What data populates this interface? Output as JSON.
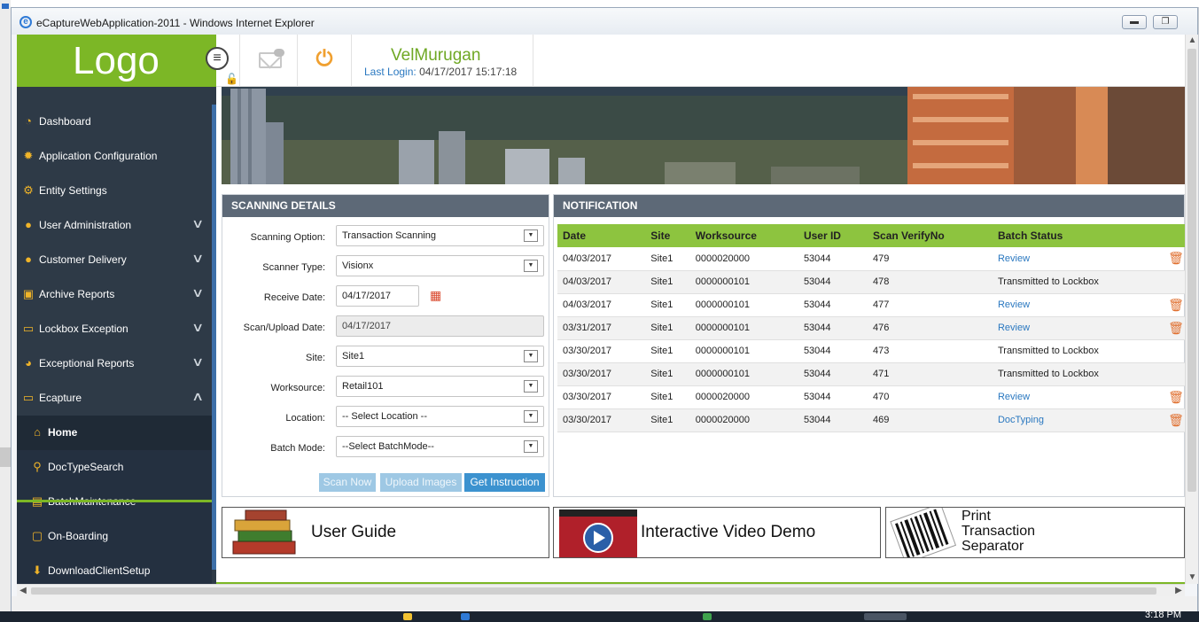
{
  "window": {
    "title": "eCaptureWebApplication-2011 - Windows Internet Explorer",
    "minimize": "▬",
    "restore": "❐"
  },
  "logo": "Logo",
  "header": {
    "username": "VelMurugan",
    "last_login_label": "Last Login:",
    "last_login_value": "04/17/2017 15:17:18"
  },
  "sidebar": {
    "items": [
      {
        "label": "Dashboard",
        "icon": "dashboard-icon",
        "glyph": "◔"
      },
      {
        "label": "Application Configuration",
        "icon": "gear-icon",
        "glyph": "✹"
      },
      {
        "label": "Entity Settings",
        "icon": "gears-icon",
        "glyph": "⚙"
      },
      {
        "label": "User Administration",
        "icon": "user-icon",
        "glyph": "●",
        "expandable": true
      },
      {
        "label": "Customer Delivery",
        "icon": "customer-icon",
        "glyph": "●",
        "expandable": true
      },
      {
        "label": "Archive Reports",
        "icon": "box-icon",
        "glyph": "▣",
        "expandable": true
      },
      {
        "label": "Lockbox Exception",
        "icon": "inbox-icon",
        "glyph": "▭",
        "expandable": true
      },
      {
        "label": "Exceptional Reports",
        "icon": "pie-chart-icon",
        "glyph": "◕",
        "expandable": true
      },
      {
        "label": "Ecapture",
        "icon": "inbox-icon",
        "glyph": "▭",
        "expandable": true,
        "expanded": true
      }
    ],
    "subitems": [
      {
        "label": "Home",
        "icon": "home-icon",
        "glyph": "⌂",
        "active": true
      },
      {
        "label": "DocTypeSearch",
        "icon": "search-icon",
        "glyph": "⚲"
      },
      {
        "label": "BatchMaintenance",
        "icon": "batch-icon",
        "glyph": "▤"
      },
      {
        "label": "On-Boarding",
        "icon": "square-icon",
        "glyph": "▢"
      },
      {
        "label": "DownloadClientSetup",
        "icon": "download-icon",
        "glyph": "⬇"
      }
    ],
    "chevron_down": "∨",
    "chevron_up": "∧"
  },
  "scanning": {
    "title": "SCANNING DETAILS",
    "fields": [
      {
        "label": "Scanning Option:",
        "value": "Transaction Scanning"
      },
      {
        "label": "Scanner Type:",
        "value": "Visionx"
      },
      {
        "label": "Receive Date:",
        "value": "04/17/2017"
      },
      {
        "label": "Scan/Upload Date:",
        "value": "04/17/2017"
      },
      {
        "label": "Site:",
        "value": "Site1"
      },
      {
        "label": "Worksource:",
        "value": "Retail101"
      },
      {
        "label": "Location:",
        "value": "-- Select Location --"
      },
      {
        "label": "Batch Mode:",
        "value": "--Select BatchMode--"
      }
    ],
    "buttons": {
      "scan_now": "Scan Now",
      "upload_images": "Upload Images",
      "get_instruction": "Get Instruction"
    }
  },
  "notification": {
    "title": "NOTIFICATION",
    "columns": [
      "Date",
      "Site",
      "Worksource",
      "User ID",
      "Scan VerifyNo",
      "Batch Status"
    ],
    "rows": [
      {
        "date": "04/03/2017",
        "site": "Site1",
        "worksource": "0000020000",
        "user": "53044",
        "verify": "479",
        "status": "Review",
        "link": true
      },
      {
        "date": "04/03/2017",
        "site": "Site1",
        "worksource": "0000000101",
        "user": "53044",
        "verify": "478",
        "status": "Transmitted to Lockbox",
        "link": false
      },
      {
        "date": "04/03/2017",
        "site": "Site1",
        "worksource": "0000000101",
        "user": "53044",
        "verify": "477",
        "status": "Review",
        "link": true
      },
      {
        "date": "03/31/2017",
        "site": "Site1",
        "worksource": "0000000101",
        "user": "53044",
        "verify": "476",
        "status": "Review",
        "link": true
      },
      {
        "date": "03/30/2017",
        "site": "Site1",
        "worksource": "0000000101",
        "user": "53044",
        "verify": "473",
        "status": "Transmitted to Lockbox",
        "link": false
      },
      {
        "date": "03/30/2017",
        "site": "Site1",
        "worksource": "0000000101",
        "user": "53044",
        "verify": "471",
        "status": "Transmitted to Lockbox",
        "link": false
      },
      {
        "date": "03/30/2017",
        "site": "Site1",
        "worksource": "0000020000",
        "user": "53044",
        "verify": "470",
        "status": "Review",
        "link": true
      },
      {
        "date": "03/30/2017",
        "site": "Site1",
        "worksource": "0000020000",
        "user": "53044",
        "verify": "469",
        "status": "DocTyping",
        "link": true
      }
    ],
    "delete_glyph": "🗑"
  },
  "tiles": {
    "user_guide": "User Guide",
    "video_demo": "Interactive Video Demo",
    "print_1": "Print",
    "print_2": "Transaction",
    "print_3": "Separator"
  },
  "taskbar": {
    "clock": "3:18 PM"
  },
  "colors": {
    "accent_green": "#7cb726",
    "sidebar_bg": "#2e3a47",
    "panel_header": "#5d6977",
    "link_blue": "#2a78c0"
  }
}
